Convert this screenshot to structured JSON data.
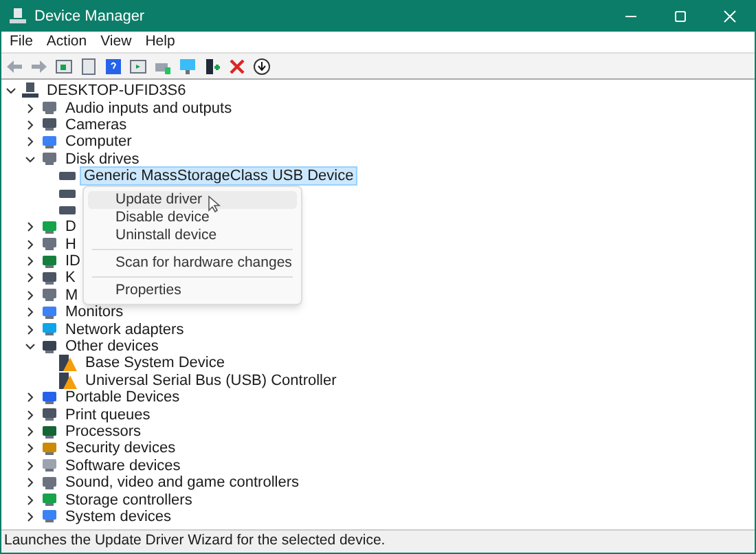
{
  "window": {
    "title": "Device Manager"
  },
  "menu_bar": [
    "File",
    "Action",
    "View",
    "Help"
  ],
  "tree": {
    "label": "DESKTOP-UFID3S6",
    "expanded": true,
    "selected": false,
    "children": [
      {
        "label": "Audio inputs and outputs",
        "expanded": false,
        "selected": false
      },
      {
        "label": "Cameras",
        "expanded": false,
        "selected": false
      },
      {
        "label": "Computer",
        "expanded": false,
        "selected": false
      },
      {
        "label": "Disk drives",
        "expanded": true,
        "selected": false,
        "children": [
          {
            "label": "Generic MassStorageClass USB Device",
            "selected": true
          },
          {
            "selected": false
          },
          {
            "selected": false
          }
        ]
      },
      {
        "label": "D",
        "expanded": false,
        "selected": false
      },
      {
        "label": "H",
        "expanded": false,
        "selected": false
      },
      {
        "label": "ID",
        "expanded": false,
        "selected": false
      },
      {
        "label": "K",
        "expanded": false,
        "selected": false
      },
      {
        "label": "M",
        "expanded": false,
        "selected": false
      },
      {
        "label": "Monitors",
        "expanded": false,
        "selected": false
      },
      {
        "label": "Network adapters",
        "expanded": false,
        "selected": false
      },
      {
        "label": "Other devices",
        "expanded": true,
        "selected": false,
        "children": [
          {
            "label": "Base System Device",
            "selected": false
          },
          {
            "label": "Universal Serial Bus (USB) Controller",
            "selected": false
          }
        ]
      },
      {
        "label": "Portable Devices",
        "expanded": false,
        "selected": false
      },
      {
        "label": "Print queues",
        "expanded": false,
        "selected": false
      },
      {
        "label": "Processors",
        "expanded": false,
        "selected": false
      },
      {
        "label": "Security devices",
        "expanded": false,
        "selected": false
      },
      {
        "label": "Software devices",
        "expanded": false,
        "selected": false
      },
      {
        "label": "Sound, video and game controllers",
        "expanded": false,
        "selected": false
      },
      {
        "label": "Storage controllers",
        "expanded": false,
        "selected": false
      },
      {
        "label": "System devices",
        "expanded": false,
        "selected": false
      }
    ]
  },
  "context_menu": [
    {
      "kind": "item",
      "label": "Update driver",
      "selected": true
    },
    {
      "kind": "item",
      "label": "Disable device",
      "selected": false
    },
    {
      "kind": "item",
      "label": "Uninstall device",
      "selected": false
    },
    {
      "kind": "separator"
    },
    {
      "kind": "item",
      "label": "Scan for hardware changes",
      "selected": false
    },
    {
      "kind": "separator"
    },
    {
      "kind": "item",
      "label": "Properties",
      "selected": false
    }
  ],
  "status_bar": "Launches the Update Driver Wizard for the selected device."
}
